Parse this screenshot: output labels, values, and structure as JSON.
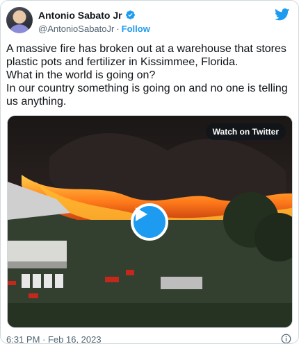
{
  "author": {
    "display_name": "Antonio Sabato Jr",
    "handle": "@AntonioSabatoJr",
    "separator": "·",
    "follow_label": "Follow"
  },
  "tweet": {
    "lines": [
      "A massive fire has broken out at a warehouse that stores",
      "plastic pots and fertilizer in Kissimmee, Florida.",
      "What in the world is going on?",
      "In our country something is going on and no one is telling",
      "us anything."
    ],
    "timestamp": "6:31 PM · Feb 16, 2023"
  },
  "media": {
    "watch_label": "Watch on Twitter"
  },
  "icons": {
    "verified": "verified-badge-icon",
    "brand": "twitter-bird-icon",
    "play": "play-icon",
    "info": "info-icon"
  },
  "colors": {
    "accent": "#1d9bf0",
    "text": "#0f1419",
    "secondary": "#536471"
  }
}
